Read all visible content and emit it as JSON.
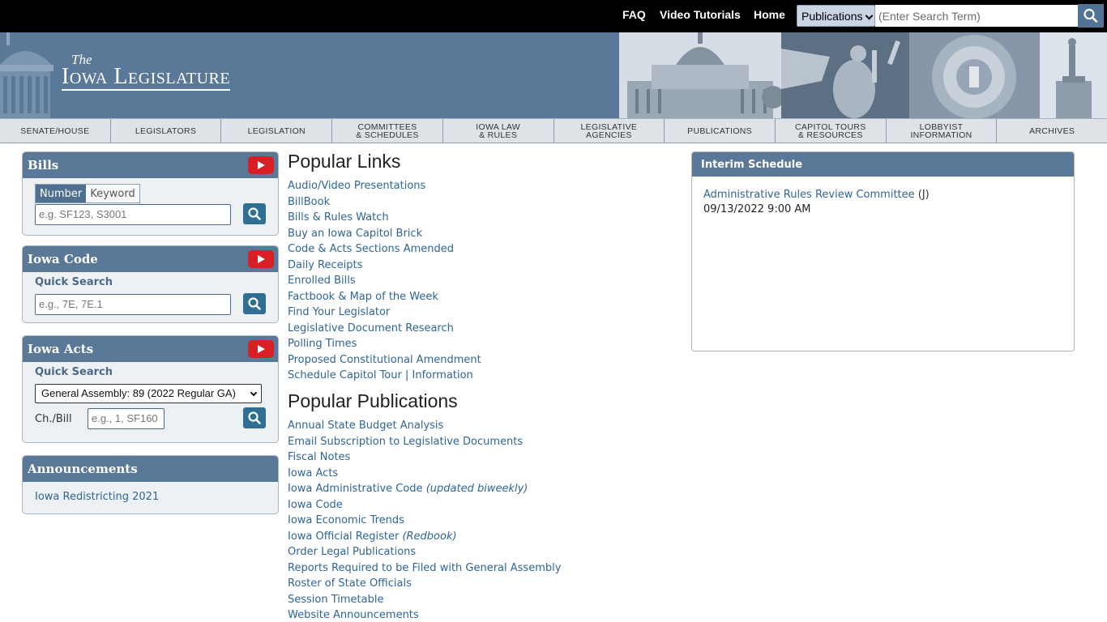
{
  "topbar": {
    "links": [
      "FAQ",
      "Video Tutorials",
      "Home"
    ],
    "scope_select": "Publications",
    "search_placeholder": "(Enter Search Term)"
  },
  "header": {
    "logo_the": "The",
    "logo_name": "Iowa Legislature"
  },
  "nav": {
    "items": [
      "SENATE/HOUSE",
      "LEGISLATORS",
      "LEGISLATION",
      "COMMITTEES\n& SCHEDULES",
      "IOWA LAW\n& RULES",
      "LEGISLATIVE\nAGENCIES",
      "PUBLICATIONS",
      "CAPITOL TOURS\n& RESOURCES",
      "LOBBYIST\nINFORMATION",
      "ARCHIVES"
    ]
  },
  "bills": {
    "title": "Bills",
    "tab_number": "Number",
    "tab_keyword": "Keyword",
    "placeholder": "e.g. SF123, S3001"
  },
  "code": {
    "title": "Iowa Code",
    "label": "Quick Search",
    "placeholder": "e.g., 7E, 7E.1"
  },
  "acts": {
    "title": "Iowa Acts",
    "label": "Quick Search",
    "select": "General Assembly: 89 (2022 Regular GA)",
    "chbill_label": "Ch./Bill",
    "placeholder": "e.g., 1, SF160"
  },
  "announcements": {
    "title": "Announcements",
    "item": "Iowa Redistricting 2021"
  },
  "popular_links": {
    "title": "Popular Links",
    "items": [
      "Audio/Video Presentations",
      "BillBook",
      "Bills & Rules Watch",
      "Buy an Iowa Capitol Brick",
      "Code & Acts Sections Amended",
      "Daily Receipts",
      "Enrolled Bills",
      "Factbook & Map of the Week",
      "Find Your Legislator",
      "Legislative Document Research",
      "Polling Times",
      "Proposed Constitutional Amendment"
    ],
    "tour_a": "Schedule Capitol Tour",
    "tour_sep": "|",
    "tour_b": "Information"
  },
  "popular_publications": {
    "title": "Popular Publications",
    "items": [
      {
        "text": "Annual State Budget Analysis",
        "note": ""
      },
      {
        "text": "Email Subscription to Legislative Documents",
        "note": ""
      },
      {
        "text": "Fiscal Notes",
        "note": ""
      },
      {
        "text": "Iowa Acts",
        "note": ""
      },
      {
        "text": "Iowa Administrative Code ",
        "note": "(updated biweekly)"
      },
      {
        "text": "Iowa Code",
        "note": ""
      },
      {
        "text": "Iowa Economic Trends",
        "note": ""
      },
      {
        "text": "Iowa Official Register ",
        "note": "(Redbook)"
      },
      {
        "text": "Order Legal Publications",
        "note": ""
      },
      {
        "text": "Reports Required to be Filed with General Assembly",
        "note": ""
      },
      {
        "text": "Roster of State Officials",
        "note": ""
      },
      {
        "text": "Session Timetable",
        "note": ""
      },
      {
        "text": "Website Announcements",
        "note": ""
      }
    ]
  },
  "interim": {
    "title": "Interim Schedule",
    "meeting": "Administrative Rules Review Committee",
    "suffix": "(J)",
    "datetime": "09/13/2022 9:00 AM"
  },
  "colors": {
    "brand_blue": "#5a7898",
    "link_blue": "#2f6597",
    "youtube_red": "#d91f26"
  }
}
